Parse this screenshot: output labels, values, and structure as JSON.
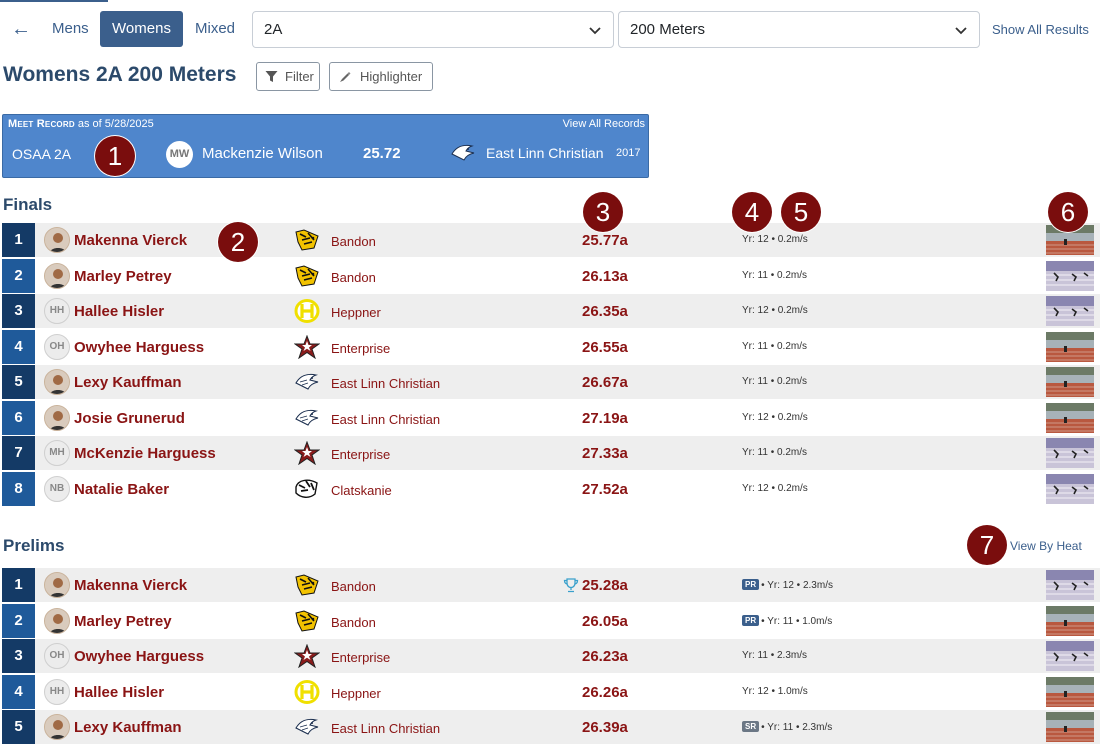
{
  "toolbar": {
    "gender_tabs": [
      {
        "label": "Mens",
        "active": false
      },
      {
        "label": "Womens",
        "active": true
      },
      {
        "label": "Mixed",
        "active": false
      }
    ],
    "classification_select": "2A",
    "event_select": "200 Meters",
    "show_all_link": "Show All Results"
  },
  "page": {
    "title": "Womens 2A 200 Meters",
    "filter_label": "Filter",
    "highlighter_label": "Highlighter"
  },
  "meet_record": {
    "heading": "Meet Record",
    "as_of": "as of 5/28/2025",
    "view_all": "View All Records",
    "org": "OSAA 2A",
    "initials": "MW",
    "athlete": "Mackenzie Wilson",
    "mark": "25.72",
    "school": "East Linn Christian",
    "year": "2017"
  },
  "finals": {
    "heading": "Finals",
    "rows": [
      {
        "place": "1",
        "initials": "",
        "photo": true,
        "name": "Makenna Vierck",
        "school": "Bandon",
        "logo": "bandon-tiger-logo",
        "mark": "25.77a",
        "pr": false,
        "sr": false,
        "meta": "Yr: 12 • 0.2m/s",
        "thumb": "track-stadium-thumb"
      },
      {
        "place": "2",
        "initials": "",
        "photo": true,
        "name": "Marley Petrey",
        "school": "Bandon",
        "logo": "bandon-tiger-logo",
        "mark": "26.13a",
        "pr": false,
        "sr": false,
        "meta": "Yr: 11 • 0.2m/s",
        "thumb": "race-finish-thumb"
      },
      {
        "place": "3",
        "initials": "HH",
        "photo": false,
        "name": "Hallee Hisler",
        "school": "Heppner",
        "logo": "heppner-h-logo",
        "mark": "26.35a",
        "pr": false,
        "sr": false,
        "meta": "Yr: 12 • 0.2m/s",
        "thumb": "race-finish-thumb"
      },
      {
        "place": "4",
        "initials": "OH",
        "photo": false,
        "name": "Owyhee Harguess",
        "school": "Enterprise",
        "logo": "enterprise-star-logo",
        "mark": "26.55a",
        "pr": false,
        "sr": false,
        "meta": "Yr: 11 • 0.2m/s",
        "thumb": "track-stadium-thumb"
      },
      {
        "place": "5",
        "initials": "",
        "photo": true,
        "name": "Lexy Kauffman",
        "school": "East Linn Christian",
        "logo": "eagle-logo",
        "mark": "26.67a",
        "pr": false,
        "sr": false,
        "meta": "Yr: 11 • 0.2m/s",
        "thumb": "track-stadium-thumb"
      },
      {
        "place": "6",
        "initials": "",
        "photo": true,
        "name": "Josie Grunerud",
        "school": "East Linn Christian",
        "logo": "eagle-logo",
        "mark": "27.19a",
        "pr": false,
        "sr": false,
        "meta": "Yr: 12 • 0.2m/s",
        "thumb": "track-stadium-thumb"
      },
      {
        "place": "7",
        "initials": "MH",
        "photo": false,
        "name": "McKenzie Harguess",
        "school": "Enterprise",
        "logo": "enterprise-star-logo",
        "mark": "27.33a",
        "pr": false,
        "sr": false,
        "meta": "Yr: 11 • 0.2m/s",
        "thumb": "race-finish-thumb"
      },
      {
        "place": "8",
        "initials": "NB",
        "photo": false,
        "name": "Natalie Baker",
        "school": "Clatskanie",
        "logo": "clatskanie-tiger-logo",
        "mark": "27.52a",
        "pr": false,
        "sr": false,
        "meta": "Yr: 12 • 0.2m/s",
        "thumb": "race-finish-thumb"
      }
    ]
  },
  "prelims": {
    "heading": "Prelims",
    "view_by_heat": "View By Heat",
    "rows": [
      {
        "place": "1",
        "initials": "",
        "photo": true,
        "name": "Makenna Vierck",
        "school": "Bandon",
        "logo": "bandon-tiger-logo",
        "mark": "25.28a",
        "trophy": true,
        "pr": true,
        "sr": false,
        "meta": "• Yr: 12 • 2.3m/s",
        "thumb": "race-finish-thumb"
      },
      {
        "place": "2",
        "initials": "",
        "photo": true,
        "name": "Marley Petrey",
        "school": "Bandon",
        "logo": "bandon-tiger-logo",
        "mark": "26.05a",
        "trophy": false,
        "pr": true,
        "sr": false,
        "meta": "• Yr: 11 • 1.0m/s",
        "thumb": "track-stadium-thumb"
      },
      {
        "place": "3",
        "initials": "OH",
        "photo": false,
        "name": "Owyhee Harguess",
        "school": "Enterprise",
        "logo": "enterprise-star-logo",
        "mark": "26.23a",
        "trophy": false,
        "pr": false,
        "sr": false,
        "meta": "Yr: 11 • 2.3m/s",
        "thumb": "race-finish-thumb"
      },
      {
        "place": "4",
        "initials": "HH",
        "photo": false,
        "name": "Hallee Hisler",
        "school": "Heppner",
        "logo": "heppner-h-logo",
        "mark": "26.26a",
        "trophy": false,
        "pr": false,
        "sr": false,
        "meta": "Yr: 12 • 1.0m/s",
        "thumb": "track-stadium-thumb"
      },
      {
        "place": "5",
        "initials": "",
        "photo": true,
        "name": "Lexy Kauffman",
        "school": "East Linn Christian",
        "logo": "eagle-logo",
        "mark": "26.39a",
        "trophy": false,
        "pr": false,
        "sr": true,
        "meta": "• Yr: 11 • 2.3m/s",
        "thumb": "track-stadium-thumb"
      }
    ]
  },
  "badges": {
    "pr": "PR",
    "sr": "SR"
  },
  "callouts": [
    "1",
    "2",
    "3",
    "4",
    "5",
    "6",
    "7"
  ],
  "colors": {
    "accent": "#3b5f8c",
    "record_bg": "#4f86cc",
    "athlete_text": "#8a1414",
    "place_dark": "#143a66",
    "place_light": "#1f5a9a",
    "callout": "#7a0d0d"
  }
}
